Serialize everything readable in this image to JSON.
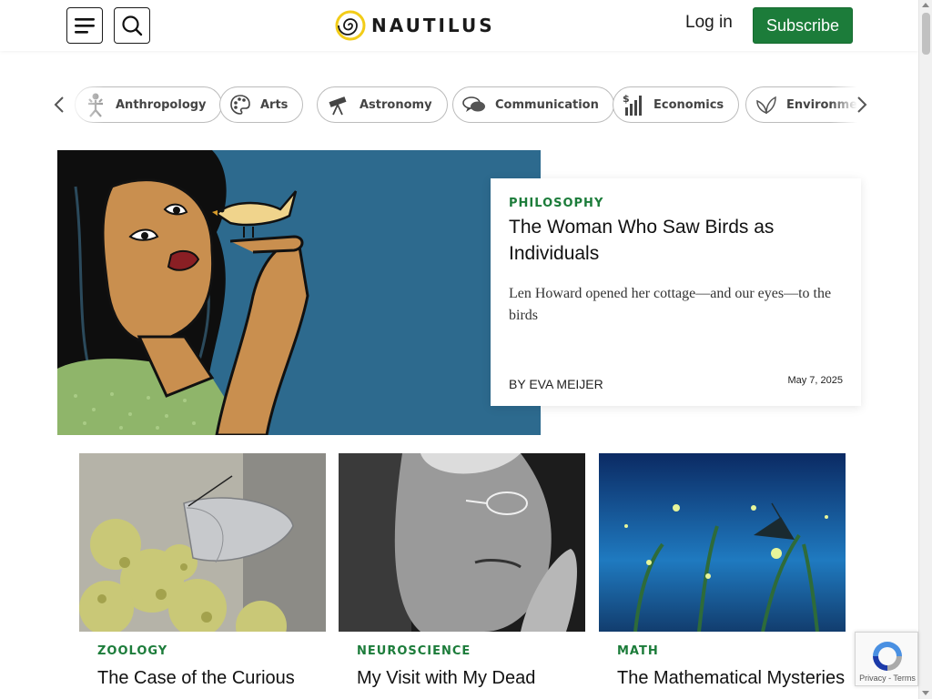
{
  "header": {
    "logo_text": "NAUTILUS",
    "login_label": "Log in",
    "subscribe_label": "Subscribe"
  },
  "topics": [
    {
      "label": "Anthropology",
      "icon": "anthropology-icon"
    },
    {
      "label": "Arts",
      "icon": "palette-icon"
    },
    {
      "label": "Astronomy",
      "icon": "telescope-icon"
    },
    {
      "label": "Communication",
      "icon": "speech-bubbles-icon"
    },
    {
      "label": "Economics",
      "icon": "bar-chart-dollar-icon"
    },
    {
      "label": "Environment",
      "icon": "leaf-icon"
    }
  ],
  "hero": {
    "kicker": "PHILOSOPHY",
    "title": "The Woman Who Saw Birds as Individuals",
    "dek": "Len Howard opened her cottage—and our eyes—to the birds",
    "byline": "BY EVA MEIJER",
    "date": "May 7, 2025"
  },
  "cards": [
    {
      "kicker": "ZOOLOGY",
      "title": "The Case of the Curious"
    },
    {
      "kicker": "NEUROSCIENCE",
      "title": "My Visit with My Dead"
    },
    {
      "kicker": "MATH",
      "title": "The Mathematical Mysteries"
    }
  ],
  "recaptcha": {
    "links": "Privacy - Terms"
  },
  "colors": {
    "accent_green": "#1c7c3a",
    "hero_bg": "#2d6a8e"
  }
}
